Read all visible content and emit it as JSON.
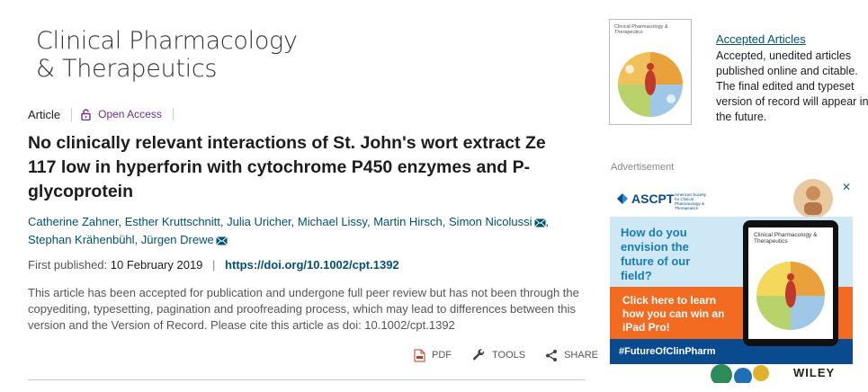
{
  "journal": {
    "line1": "Clinical Pharmacology",
    "line2": "& Therapeutics"
  },
  "article_meta": {
    "type": "Article",
    "access": "Open Access"
  },
  "article": {
    "title": "No clinically relevant interactions of St. John's wort extract Ze 117 low in hyperforin with cytochrome P450 enzymes and P-glycoprotein",
    "authors": [
      {
        "name": "Catherine Zahner",
        "corresponding": false
      },
      {
        "name": "Esther Kruttschnitt",
        "corresponding": false
      },
      {
        "name": "Julia Uricher",
        "corresponding": false
      },
      {
        "name": "Michael Lissy",
        "corresponding": false
      },
      {
        "name": "Martin Hirsch",
        "corresponding": false
      },
      {
        "name": "Simon Nicolussi",
        "corresponding": true
      },
      {
        "name": "Stephan Krähenbühl",
        "corresponding": false
      },
      {
        "name": "Jürgen Drewe",
        "corresponding": true
      }
    ],
    "first_published_label": "First published:",
    "first_published_date": "10 February 2019",
    "doi": "https://doi.org/10.1002/cpt.1392",
    "notice": "This article has been accepted for publication and undergone full peer review but has not been through the copyediting, typesetting, pagination and proofreading process, which may lead to differences between this version and the Version of Record. Please cite this article as doi: 10.1002/cpt.1392"
  },
  "actions": {
    "pdf": "PDF",
    "tools": "TOOLS",
    "share": "SHARE"
  },
  "sidebar": {
    "cover_title": "Clinical Pharmacology & Therapeutics",
    "accepted_link": "Accepted Articles",
    "accepted_desc": "Accepted, unedited articles published online and citable. The final edited and typeset version of record will appear in the future.",
    "ad_label": "Advertisement"
  },
  "ad": {
    "brand": "ASCPT",
    "brand_sub": "American Society for Clinical Pharmacology & Therapeutics",
    "question": "How do you envision the future of our field?",
    "cta": "Click here to learn how you can win an iPad Pro!",
    "hashtag": "#FutureOfClinPharm",
    "publisher": "WILEY",
    "ipad_title": "Clinical Pharmacology & Therapeutics",
    "close": "✕"
  },
  "colors": {
    "link": "#005274",
    "open_access": "#6d2e8a",
    "ad_orange": "#f26b21",
    "ad_blue": "#cfe8f5"
  }
}
